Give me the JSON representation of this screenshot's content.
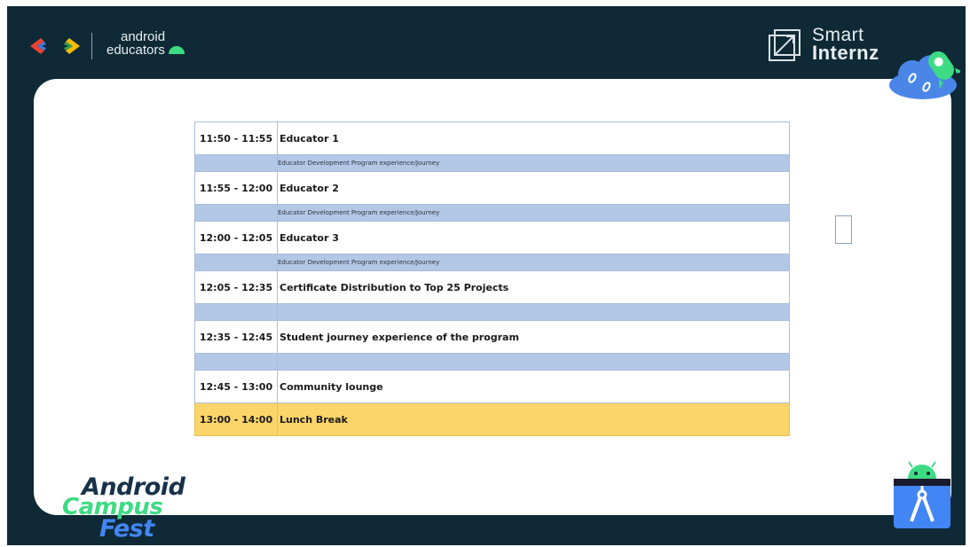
{
  "header": {
    "brand_line1": "android",
    "brand_line2": "educators",
    "partner_line1": "Smart",
    "partner_line2": "Internz"
  },
  "schedule": [
    {
      "time": "11:50 - 11:55",
      "title": "Educator 1",
      "subtitle": "Educator Development Program experience/Journey"
    },
    {
      "time": "11:55 - 12:00",
      "title": "Educator 2",
      "subtitle": "Educator Development Program experience/Journey"
    },
    {
      "time": "12:00 - 12:05",
      "title": "Educator 3",
      "subtitle": "Educator Development Program experience/Journey"
    },
    {
      "time": "12:05 - 12:35",
      "title": "Certificate Distribution to Top 25 Projects",
      "subtitle": ""
    },
    {
      "time": "12:35 - 12:45",
      "title": "Student journey experience of the program",
      "subtitle": ""
    },
    {
      "time": "12:45 - 13:00",
      "title": "Community lounge"
    },
    {
      "time": "13:00 - 14:00",
      "title": "Lunch Break"
    }
  ],
  "footer": {
    "event_word1": "Android",
    "event_word2": "Campus",
    "event_word3": "Fest"
  },
  "colors": {
    "frame": "#0f2a36",
    "sub_row": "#b3c7e6",
    "lunch_row": "#fbd46a",
    "android_green": "#3ddc84",
    "google_blue": "#4285f4"
  }
}
